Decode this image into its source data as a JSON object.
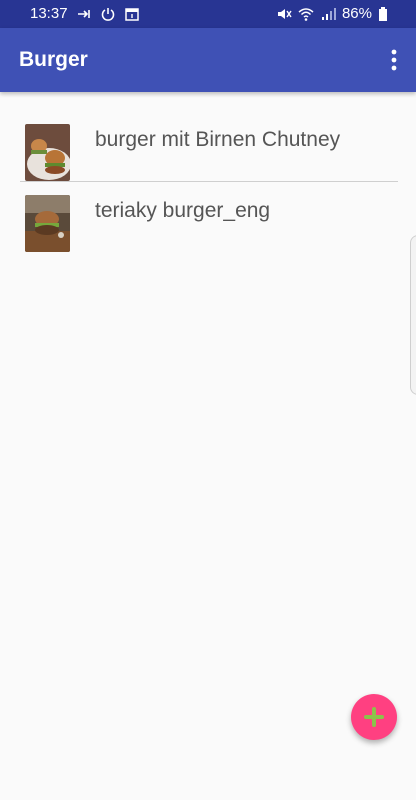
{
  "status": {
    "time": "13:37",
    "battery": "86%",
    "icons_left": [
      "call-forward-icon",
      "power-icon",
      "calendar-icon"
    ],
    "icons_right": [
      "mute-icon",
      "wifi-icon",
      "signal-icon",
      "battery-icon"
    ]
  },
  "appbar": {
    "title": "Burger",
    "menu_icon": "overflow-menu-icon"
  },
  "recipes": [
    {
      "name": "burger mit Birnen Chutney",
      "thumbnail": "burger-photo-icon"
    },
    {
      "name": "teriaky burger_eng",
      "thumbnail": "burger-photo-icon"
    }
  ],
  "fab": {
    "icon": "plus-icon"
  },
  "colors": {
    "statusbar": "#283593",
    "appbar": "#3f51b5",
    "fab": "#ff4081",
    "fab_icon": "#8bc34a"
  }
}
